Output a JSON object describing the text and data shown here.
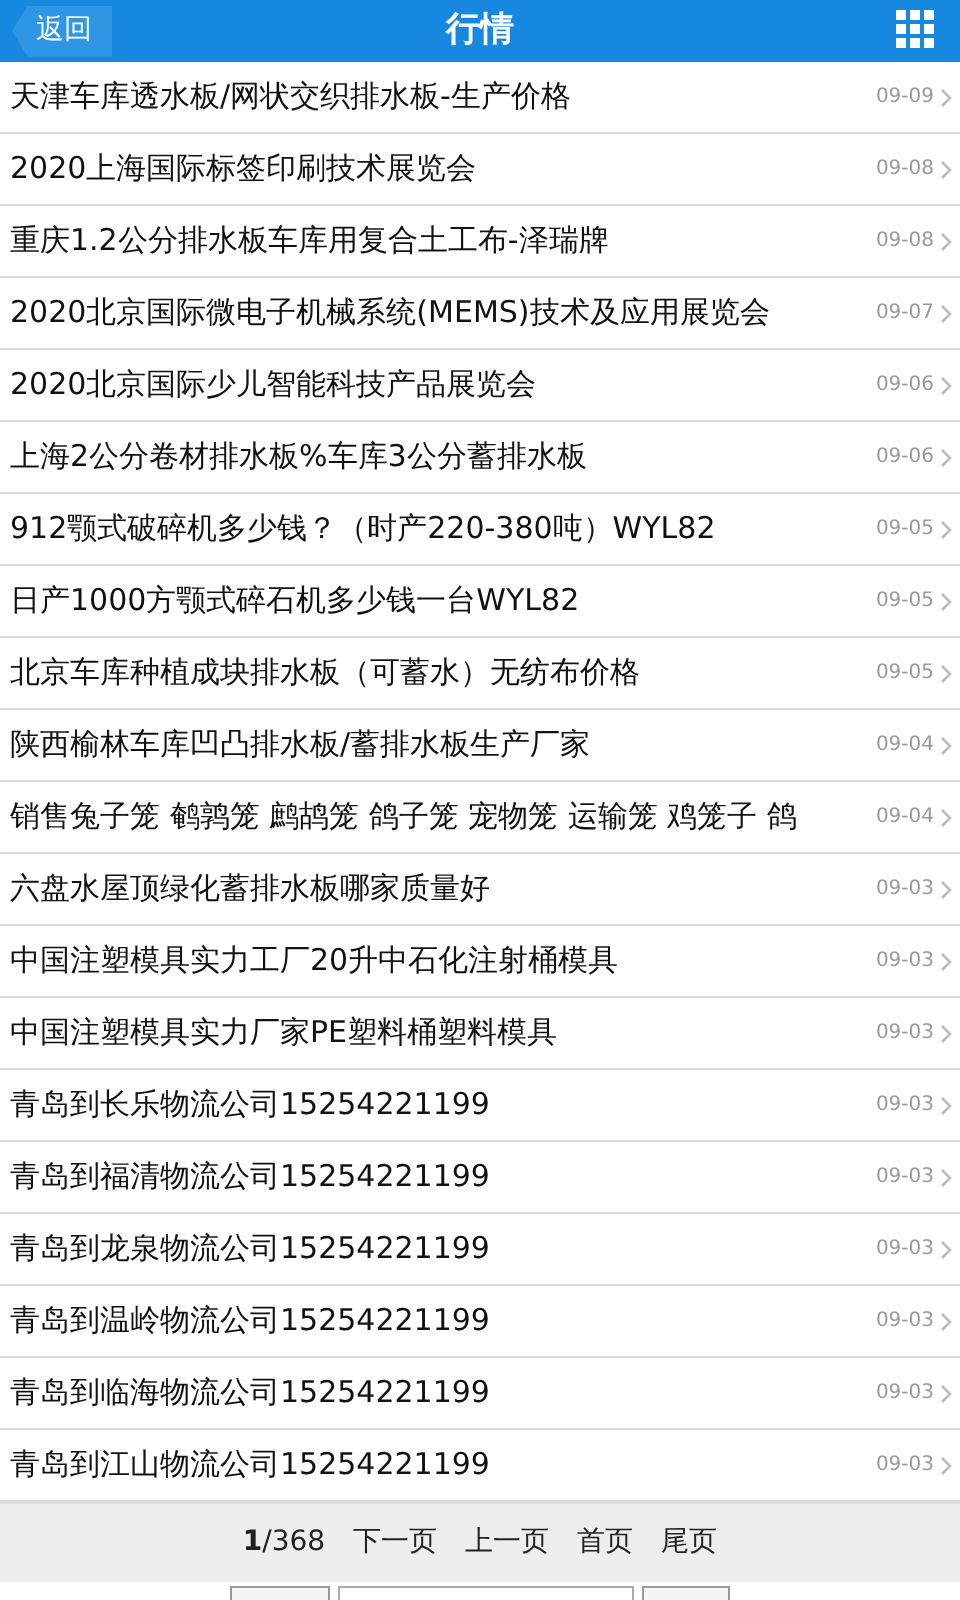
{
  "header": {
    "back": "返回",
    "title": "行情"
  },
  "items": [
    {
      "title": "天津车库透水板/网状交织排水板-生产价格",
      "date": "09-09"
    },
    {
      "title": "2020上海国际标签印刷技术展览会",
      "date": "09-08"
    },
    {
      "title": "重庆1.2公分排水板车库用复合土工布-泽瑞牌",
      "date": "09-08"
    },
    {
      "title": "2020北京国际微电子机械系统(MEMS)技术及应用展览会",
      "date": "09-07"
    },
    {
      "title": "2020北京国际少儿智能科技产品展览会",
      "date": "09-06"
    },
    {
      "title": "上海2公分卷材排水板%车库3公分蓄排水板",
      "date": "09-06"
    },
    {
      "title": "912颚式破碎机多少钱？（时产220-380吨）WYL82",
      "date": "09-05"
    },
    {
      "title": "日产1000方颚式碎石机多少钱一台WYL82",
      "date": "09-05"
    },
    {
      "title": "北京车库种植成块排水板（可蓄水）无纺布价格",
      "date": "09-05"
    },
    {
      "title": "陕西榆林车库凹凸排水板/蓄排水板生产厂家",
      "date": "09-04"
    },
    {
      "title": "销售兔子笼 鹌鹑笼 鹧鸪笼 鸽子笼 宠物笼 运输笼 鸡笼子 鸽",
      "date": "09-04"
    },
    {
      "title": "六盘水屋顶绿化蓄排水板哪家质量好",
      "date": "09-03"
    },
    {
      "title": "中国注塑模具实力工厂20升中石化注射桶模具",
      "date": "09-03"
    },
    {
      "title": "中国注塑模具实力厂家PE塑料桶塑料模具",
      "date": "09-03"
    },
    {
      "title": "青岛到长乐物流公司15254221199",
      "date": "09-03"
    },
    {
      "title": "青岛到福清物流公司15254221199",
      "date": "09-03"
    },
    {
      "title": "青岛到龙泉物流公司15254221199",
      "date": "09-03"
    },
    {
      "title": "青岛到温岭物流公司15254221199",
      "date": "09-03"
    },
    {
      "title": "青岛到临海物流公司15254221199",
      "date": "09-03"
    },
    {
      "title": "青岛到江山物流公司15254221199",
      "date": "09-03"
    }
  ],
  "pager": {
    "page": "**1**/368",
    "links": [
      "下一页",
      "上一页",
      "首页",
      "尾页"
    ]
  }
}
